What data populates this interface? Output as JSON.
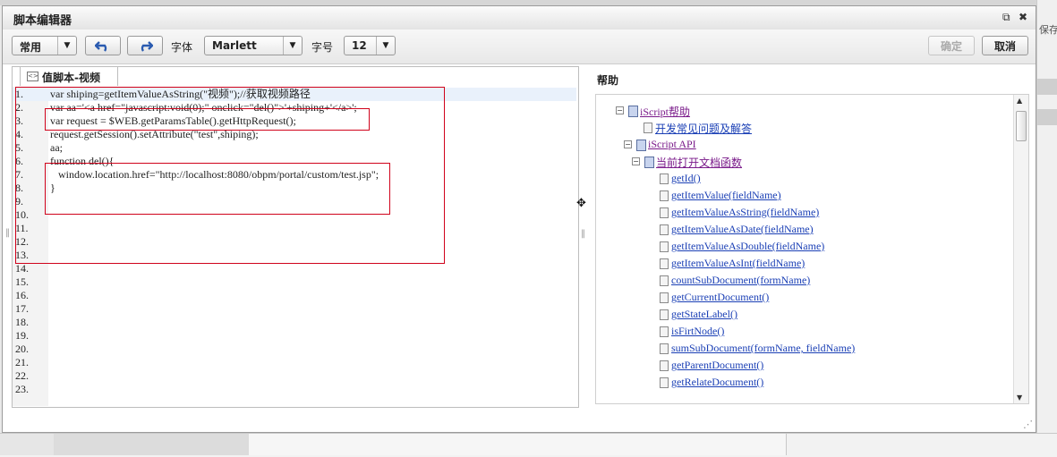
{
  "background": {
    "save_label": "保存"
  },
  "dialog": {
    "title": "脚本编辑器",
    "popout_icon": "external-link-icon",
    "close_icon": "close-icon"
  },
  "toolbar": {
    "mode_select": "常用",
    "undo_icon": "undo-icon",
    "redo_icon": "redo-icon",
    "font_label": "字体",
    "font_value": "Marlett",
    "size_label": "字号",
    "size_value": "12",
    "confirm_label": "确定",
    "cancel_label": "取消"
  },
  "editor": {
    "tab_label": "值脚本-视频",
    "lines": [
      {
        "n": "1.",
        "text": "var shiping=getItemValueAsString(\"视频\");//获取视频路径"
      },
      {
        "n": "2.",
        "text": "var aa='<a href=\"javascript:void(0);\" onclick=\"del()\">'+shiping+'</a>';"
      },
      {
        "n": "3.",
        "text": "var request = $WEB.getParamsTable().getHttpRequest();"
      },
      {
        "n": "4.",
        "text": "request.getSession().setAttribute(\"test\",shiping);"
      },
      {
        "n": "5.",
        "text": "aa;"
      },
      {
        "n": "6.",
        "text": "function del(){"
      },
      {
        "n": "7.",
        "text": "   window.location.href=\"http://localhost:8080/obpm/portal/custom/test.jsp\";"
      },
      {
        "n": "8.",
        "text": "}"
      },
      {
        "n": "9.",
        "text": ""
      },
      {
        "n": "10.",
        "text": ""
      },
      {
        "n": "11.",
        "text": ""
      },
      {
        "n": "12.",
        "text": ""
      },
      {
        "n": "13.",
        "text": ""
      },
      {
        "n": "14.",
        "text": ""
      },
      {
        "n": "15.",
        "text": ""
      },
      {
        "n": "16.",
        "text": ""
      },
      {
        "n": "17.",
        "text": ""
      },
      {
        "n": "18.",
        "text": ""
      },
      {
        "n": "19.",
        "text": ""
      },
      {
        "n": "20.",
        "text": ""
      },
      {
        "n": "21.",
        "text": ""
      },
      {
        "n": "22.",
        "text": ""
      },
      {
        "n": "23.",
        "text": ""
      }
    ]
  },
  "help": {
    "title": "帮助",
    "items": [
      {
        "label": "iScript帮助",
        "kind": "book",
        "toggle": "⊟",
        "visited": true
      },
      {
        "label": "开发常见问题及解答",
        "kind": "doc",
        "toggle": "",
        "visited": false
      },
      {
        "label": "iScript API",
        "kind": "book",
        "toggle": "⊟",
        "visited": true
      },
      {
        "label": "当前打开文档函数",
        "kind": "book",
        "toggle": "⊟",
        "visited": true
      },
      {
        "label": "getId()",
        "kind": "doc",
        "toggle": "",
        "visited": false
      },
      {
        "label": "getItemValue(fieldName)",
        "kind": "doc",
        "toggle": "",
        "visited": false
      },
      {
        "label": "getItemValueAsString(fieldName)",
        "kind": "doc",
        "toggle": "",
        "visited": false
      },
      {
        "label": "getItemValueAsDate(fieldName)",
        "kind": "doc",
        "toggle": "",
        "visited": false
      },
      {
        "label": "getItemValueAsDouble(fieldName)",
        "kind": "doc",
        "toggle": "",
        "visited": false
      },
      {
        "label": "getItemValueAsInt(fieldName)",
        "kind": "doc",
        "toggle": "",
        "visited": false
      },
      {
        "label": "countSubDocument(formName)",
        "kind": "doc",
        "toggle": "",
        "visited": false
      },
      {
        "label": "getCurrentDocument()",
        "kind": "doc",
        "toggle": "",
        "visited": false
      },
      {
        "label": "getStateLabel()",
        "kind": "doc",
        "toggle": "",
        "visited": false
      },
      {
        "label": "isFirtNode()",
        "kind": "doc",
        "toggle": "",
        "visited": false
      },
      {
        "label": "sumSubDocument(formName, fieldName)",
        "kind": "doc",
        "toggle": "",
        "visited": false
      },
      {
        "label": "getParentDocument()",
        "kind": "doc",
        "toggle": "",
        "visited": false
      },
      {
        "label": "getRelateDocument()",
        "kind": "doc",
        "toggle": "",
        "visited": false
      }
    ]
  },
  "colors": {
    "annotation": "#d0021b",
    "link": "#1a3fb5",
    "visited_link": "#7a1a8a"
  }
}
